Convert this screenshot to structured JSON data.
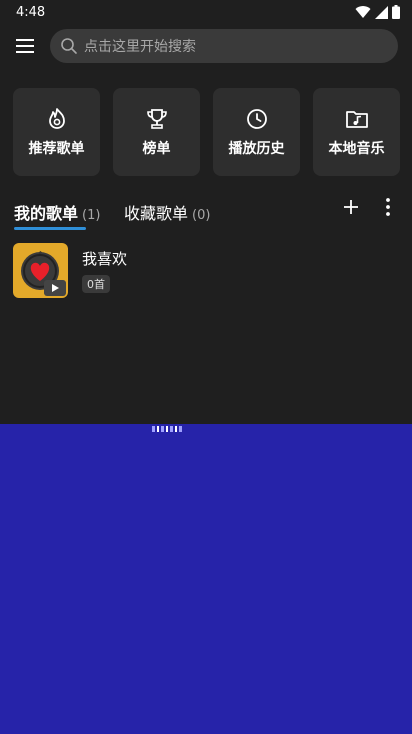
{
  "status_bar": {
    "time": "4:48"
  },
  "search": {
    "placeholder": "点击这里开始搜索"
  },
  "quick_access": [
    {
      "label": "推荐歌单",
      "icon": "flame-icon"
    },
    {
      "label": "榜单",
      "icon": "trophy-icon"
    },
    {
      "label": "播放历史",
      "icon": "clock-icon"
    },
    {
      "label": "本地音乐",
      "icon": "music-folder-icon"
    }
  ],
  "tabs": {
    "mine_label": "我的歌单",
    "mine_count": "(1)",
    "fav_label": "收藏歌单",
    "fav_count": "(0)"
  },
  "playlists": [
    {
      "title": "我喜欢",
      "count": "0首"
    }
  ],
  "colors": {
    "background": "#1f1f1f",
    "card": "#2e2e2e",
    "accent": "#2f8fd8",
    "cover": "#e3a92a",
    "heart": "#e8202a",
    "overlay_panel": "#2623a9"
  }
}
